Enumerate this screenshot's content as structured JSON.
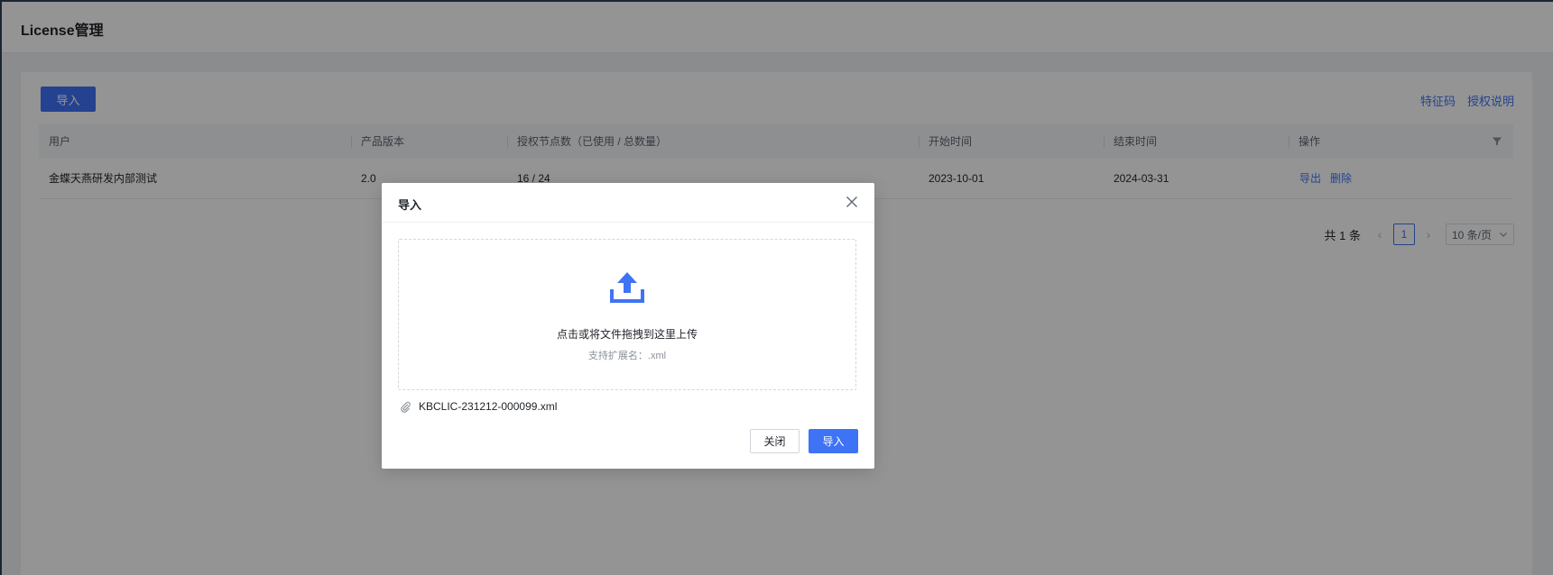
{
  "page": {
    "title": "License管理"
  },
  "toolbar": {
    "import_label": "导入",
    "feature_code_link": "特征码",
    "license_doc_link": "授权说明"
  },
  "table": {
    "columns": [
      "用户",
      "产品版本",
      "授权节点数（已使用 / 总数量）",
      "开始时间",
      "结束时间",
      "操作"
    ],
    "rows": [
      {
        "user": "金蝶天燕研发内部测试",
        "version": "2.0",
        "nodes": "16 / 24",
        "start": "2023-10-01",
        "end": "2024-03-31",
        "action_export": "导出",
        "action_delete": "删除"
      }
    ]
  },
  "pagination": {
    "total": "共 1 条",
    "current": "1",
    "page_size": "10 条/页"
  },
  "modal": {
    "title": "导入",
    "drop_text": "点击或将文件拖拽到这里上传",
    "drop_hint": "支持扩展名：.xml",
    "file_name": "KBCLIC-231212-000099.xml",
    "close_label": "关闭",
    "confirm_label": "导入"
  },
  "colors": {
    "primary": "#3f73f6",
    "mask": "rgba(0,0,0,0.42)"
  },
  "icons": {
    "filter": "filter-icon",
    "close": "close-icon",
    "upload": "upload-icon",
    "attachment": "paperclip-icon",
    "prev": "chevron-left-icon",
    "next": "chevron-right-icon",
    "dropdown": "chevron-down-icon"
  }
}
